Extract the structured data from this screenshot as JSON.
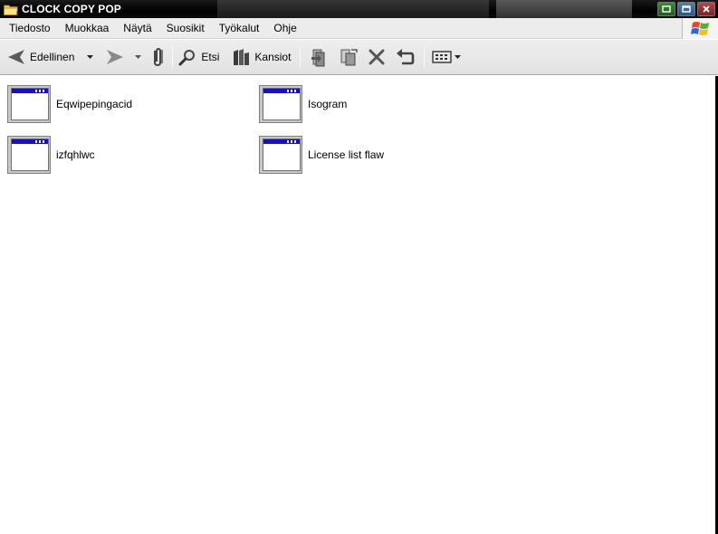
{
  "window": {
    "title": "CLOCK COPY POP"
  },
  "menubar": {
    "items": [
      "Tiedosto",
      "Muokkaa",
      "Näytä",
      "Suosikit",
      "Työkalut",
      "Ohje"
    ]
  },
  "toolbar": {
    "back_label": "Edellinen",
    "search_label": "Etsi",
    "folders_label": "Kansiot"
  },
  "files": [
    {
      "name": "Eqwipepingacid"
    },
    {
      "name": "Isogram"
    },
    {
      "name": "izfqhlwc"
    },
    {
      "name": "License list flaw"
    }
  ],
  "colors": {
    "titlebar": "#000000",
    "menubar": "#ececec",
    "icon_titlebar": "#1414b4"
  }
}
